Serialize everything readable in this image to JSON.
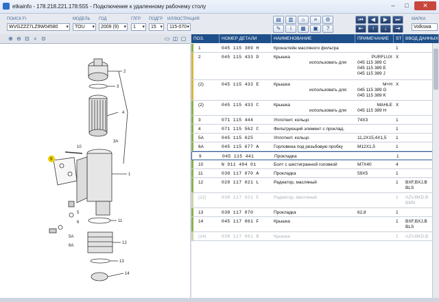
{
  "window": {
    "title": "etkainfo - 178.218.221.178:555 - Подключение к удаленному рабочему столу",
    "min": "–",
    "max": "□",
    "close": "✕"
  },
  "selectors": {
    "vin_label": "ПОИСК FI",
    "vin_value": "WVGZZZ7LZ9W04580",
    "model_label": "МОДЕЛЬ",
    "model_value": "TOU",
    "year_label": "ГОД",
    "year_value": "2009 (9)",
    "group_label": "ГЛГР",
    "group_value": "1",
    "subgroup_label": "ПОДГР",
    "subgroup_value": "15",
    "illus_label": "ИЛЛЮСТРАЦИЯ",
    "illus_value": "115-070",
    "brand_label": "МАРКА",
    "brand_value": "Volkswa"
  },
  "diagram_callouts": {
    "c1": "1",
    "c2": "2",
    "c3": "3",
    "c3a": "3A",
    "c4": "4",
    "c5": "5",
    "c5a": "5A",
    "c6": "6",
    "c6a": "6A",
    "c9": "9",
    "c10": "10",
    "c11": "11",
    "c12": "12",
    "c13": "13",
    "c14": "14"
  },
  "table": {
    "columns": [
      "ПОЗ.",
      "НОМЕР ДЕТАЛИ",
      "НАИМЕНОВАНИЕ",
      "ПРИМЕЧАНИЕ",
      "ST",
      "ВВОД ДАННЫХ"
    ],
    "rows": [
      {
        "pos": "1",
        "part": "045 115 389 H",
        "name": "Кронштейн масляного фильтра",
        "note": "",
        "use_label": "",
        "use_parts": [],
        "st": "1",
        "extra": "",
        "marker": "#8ab04a"
      },
      {
        "pos": "2",
        "part": "045 115 433 D",
        "name": "Крышка",
        "note": "PURFLUX",
        "use_label": "использовать для:",
        "use_parts": [
          "045 115 389 C",
          "045 115 389 E",
          "045 115 389 J"
        ],
        "st": "X",
        "extra": "",
        "marker": "#d8b43c"
      },
      {
        "pos": "(2)",
        "part": "045 115 433 E",
        "name": "Крышка",
        "note": "M+H",
        "use_label": "использовать для:",
        "use_parts": [
          "045 115 389 G",
          "045 115 389 K"
        ],
        "st": "X",
        "extra": "",
        "marker": "#d8b43c"
      },
      {
        "pos": "(2)",
        "part": "045 115 433 C",
        "name": "Крышка",
        "note": "MAHLE",
        "use_label": "использовать для:",
        "use_parts": [
          "045 115 389 H"
        ],
        "st": "X",
        "extra": "",
        "marker": "#8ab04a"
      },
      {
        "pos": "3",
        "part": "071 115 444",
        "name": "Уплотнит. кольцо",
        "note": "74X3",
        "use_label": "",
        "use_parts": [],
        "st": "1",
        "extra": "",
        "marker": "#8ab04a"
      },
      {
        "pos": "4",
        "part": "071 115 562 C",
        "name": "Фильтрующий элемент с проклад.",
        "note": "",
        "use_label": "",
        "use_parts": [],
        "st": "1",
        "extra": "",
        "marker": "#8ab04a"
      },
      {
        "pos": "5A",
        "part": "045 115 625",
        "name": "Уплотнит. кольцо",
        "note": "11,2X15,4X1,5",
        "use_label": "",
        "use_parts": [],
        "st": "1",
        "extra": "",
        "marker": "#8ab04a"
      },
      {
        "pos": "6A",
        "part": "045 115 677 A",
        "name": "Горловина под резьбовую пробку",
        "note": "M12X1,5",
        "use_label": "",
        "use_parts": [],
        "st": "1",
        "extra": "",
        "marker": "#8ab04a"
      },
      {
        "pos": "9",
        "part": "045 115 441",
        "name": "Прокладка",
        "note": "",
        "use_label": "",
        "use_parts": [],
        "st": "1",
        "extra": "",
        "marker": ""
      },
      {
        "pos": "10",
        "part": "N  911 494 01",
        "name": "Болт с шестигранной головкой",
        "note": "M7X40",
        "use_label": "",
        "use_parts": [],
        "st": "4",
        "extra": "",
        "marker": "#8ab04a"
      },
      {
        "pos": "11",
        "part": "038 117 070 A",
        "name": "Прокладка",
        "note": "59X5",
        "use_label": "",
        "use_parts": [],
        "st": "1",
        "extra": "",
        "marker": "#8ab04a"
      },
      {
        "pos": "12",
        "part": "028 117 021 L",
        "name": "Радиатор, масляный",
        "note": "",
        "use_label": "",
        "use_parts": [],
        "st": "1",
        "extra": "BXF,BXJ,B\nBLS",
        "marker": "#8ab04a"
      },
      {
        "pos": "(12)",
        "part": "038 117 021 E",
        "name": "Радиатор, масляный",
        "note": "",
        "use_label": "",
        "use_parts": [],
        "st": "1",
        "extra": "AZV,BKD,B\nBMN",
        "marker": "#c7d6a8"
      },
      {
        "pos": "13",
        "part": "038 117 070",
        "name": "Прокладка",
        "note": "62,8",
        "use_label": "",
        "use_parts": [],
        "st": "1",
        "extra": "",
        "marker": "#8ab04a"
      },
      {
        "pos": "14",
        "part": "045 117 061 F",
        "name": "Крышка",
        "note": "",
        "use_label": "",
        "use_parts": [],
        "st": "1",
        "extra": "BXF,BXJ,B\nBLS",
        "marker": "#8ab04a"
      },
      {
        "pos": "(14)",
        "part": "038 117 061 B",
        "name": "Крышка",
        "note": "",
        "use_label": "",
        "use_parts": [],
        "st": "1",
        "extra": "AZV,BKD,B",
        "marker": "#c7d6a8"
      }
    ]
  }
}
